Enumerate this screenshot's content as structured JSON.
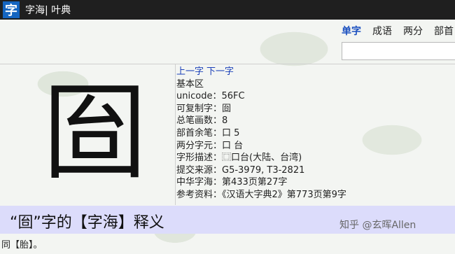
{
  "app": {
    "logo_glyph": "字",
    "title": "字海| 叶典"
  },
  "tabs": [
    {
      "label": "单字",
      "active": true
    },
    {
      "label": "成语",
      "active": false
    },
    {
      "label": "两分",
      "active": false
    },
    {
      "label": "部首",
      "active": false
    }
  ],
  "search": {
    "value": "",
    "placeholder": ""
  },
  "character": {
    "glyph": "囼",
    "nav": {
      "prev": "上一字",
      "next": "下一字"
    },
    "block": "基本区",
    "unicode": "unicode：56FC",
    "copyable": "可复制字：囼",
    "strokes": "总笔画数：8",
    "radical": "部首余笔：口 5",
    "split": "两分字元：口 台",
    "shape": "字形描述：⿴口台(大陆、台湾)",
    "source": "提交来源：G5-3979, T3-2821",
    "zhonghua": "中华字海：第433页第27字",
    "reference": "参考资料：《汉语大字典2》第773页第9字"
  },
  "banner": {
    "title": "“囼”字的【字海】释义",
    "watermark": "知乎 @玄晖Allen"
  },
  "definition": {
    "prefix": "同",
    "link": "【胎】",
    "suffix": "。"
  },
  "colors": {
    "topbar": "#1f1f1f",
    "logo": "#1565c0",
    "banner": "#dcdcfb",
    "link": "#1a3fb8"
  }
}
